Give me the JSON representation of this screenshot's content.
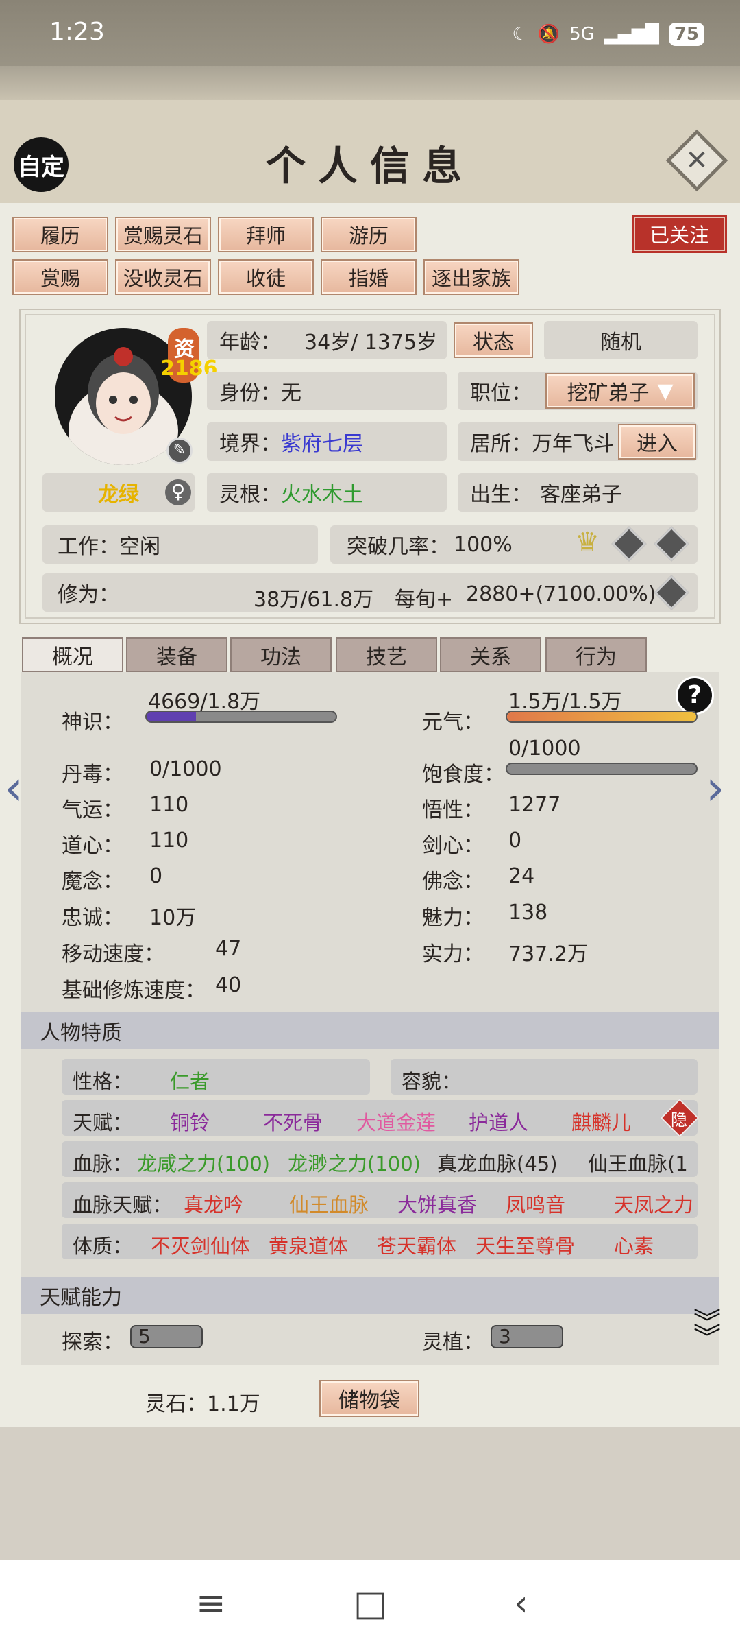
{
  "status_bar": {
    "time": "1:23",
    "battery": "75",
    "network": "5G"
  },
  "header": {
    "title": "个人信息",
    "custom_label": "自定"
  },
  "top_buttons": [
    "履历",
    "赏赐灵石",
    "拜师",
    "游历",
    "赏赐",
    "没收灵石",
    "收徒",
    "指婚",
    "逐出家族"
  ],
  "followed": "已关注",
  "character": {
    "name": "龙绿",
    "aptitude_label": "资",
    "aptitude_value": "2186",
    "age_label": "年龄：",
    "age": "34岁/ 1375岁",
    "status_btn": "状态",
    "random_btn": "随机",
    "identity_label": "身份：",
    "identity": "无",
    "position_label": "职位：",
    "position": "挖矿弟子",
    "realm_label": "境界：",
    "realm": "紫府七层",
    "residence_label": "居所：",
    "residence": "万年飞斗",
    "enter_btn": "进入",
    "root_label": "灵根：",
    "root": "火水木土",
    "birth_label": "出生：",
    "birth": "客座弟子",
    "job": "工作：空闲",
    "breakthrough_label": "突破几率：",
    "breakthrough": "100%",
    "cultivation_label": "修为：",
    "cultivation": "38万/61.8万",
    "per_turn_label": "每旬+",
    "per_turn": "2880+(7100.00%)"
  },
  "tabs": [
    "概况",
    "装备",
    "功法",
    "技艺",
    "关系",
    "行为"
  ],
  "stats": {
    "shenshi_label": "神识：",
    "shenshi": "4669/1.8万",
    "shenshi_fill": 0.26,
    "yuanqi_label": "元气：",
    "yuanqi": "1.5万/1.5万",
    "yuanqi_fill": 1.0,
    "dandu_label": "丹毒：",
    "dandu": "0/1000",
    "baoshi_label": "饱食度：",
    "baoshi": "0/1000",
    "baoshi_fill": 0.0,
    "qiyun_label": "气运：",
    "qiyun": "110",
    "wuxing_label": "悟性：",
    "wuxing": "1277",
    "daoxin_label": "道心：",
    "daoxin": "110",
    "jianxin_label": "剑心：",
    "jianxin": "0",
    "monian_label": "魔念：",
    "monian": "0",
    "fonian_label": "佛念：",
    "fonian": "24",
    "zhongcheng_label": "忠诚：",
    "zhongcheng": "10万",
    "meili_label": "魅力：",
    "meili": "138",
    "speed_label": "移动速度：",
    "speed": "47",
    "shili_label": "实力：",
    "shili": "737.2万",
    "base_speed_label": "基础修炼速度：",
    "base_speed": "40"
  },
  "traits": {
    "section": "人物特质",
    "personality_label": "性格：",
    "personality": "仁者",
    "looks_label": "容貌：",
    "talent_label": "天赋：",
    "talents": [
      "铜铃",
      "不死骨",
      "大道金莲",
      "护道人",
      "麒麟儿"
    ],
    "hide": "隐",
    "blood_label": "血脉：",
    "bloods": [
      "龙咸之力(100)",
      "龙渺之力(100)",
      "真龙血脉(45)",
      "仙王血脉(1"
    ],
    "blood_talent_label": "血脉天赋：",
    "blood_talents": [
      "真龙吟",
      "仙王血脉",
      "大饼真香",
      "凤鸣音",
      "天凤之力"
    ],
    "physique_label": "体质：",
    "physiques": [
      "不灭剑仙体",
      "黄泉道体",
      "苍天霸体",
      "天生至尊骨",
      "心素"
    ]
  },
  "abilities": {
    "section": "天赋能力",
    "explore_label": "探索：",
    "explore": "5",
    "plant_label": "灵植：",
    "plant": "3"
  },
  "bottom": {
    "spirit_stones": "灵石：1.1万",
    "storage_btn": "储物袋"
  },
  "colors": {
    "realm": "#3a3ad0",
    "root": "#2f9a2f",
    "gold": "#d28a2a",
    "purple": "#8a2a9a",
    "pink": "#e05aa0",
    "red": "#d6322a",
    "green": "#3a9a2a"
  }
}
